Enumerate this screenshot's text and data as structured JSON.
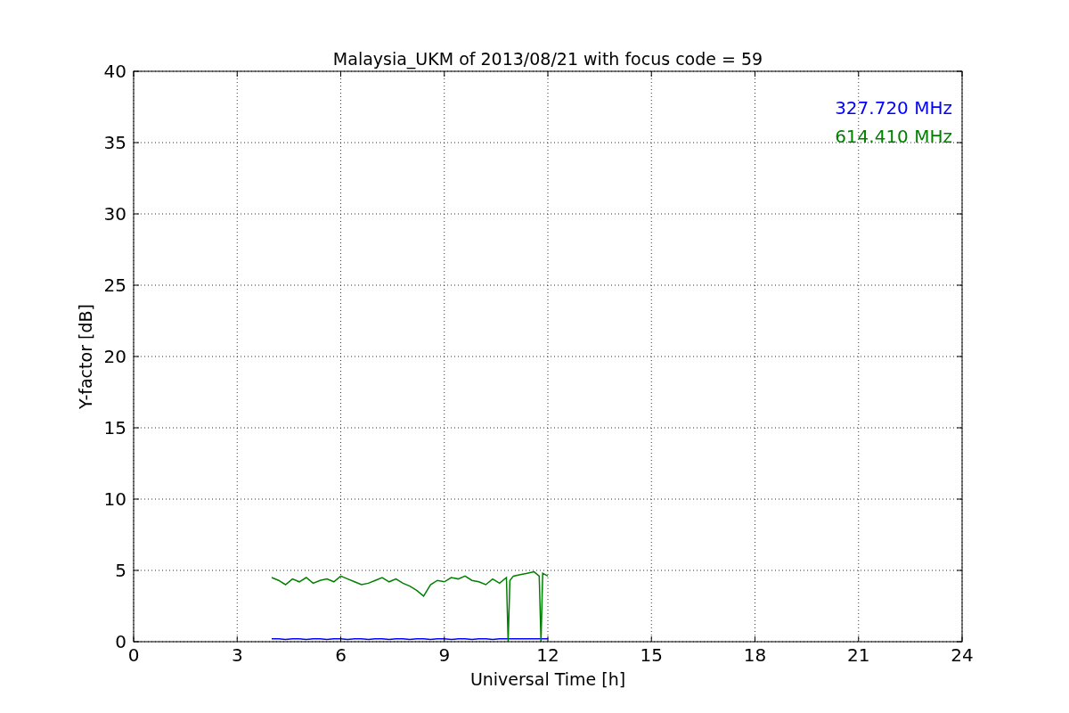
{
  "chart_data": {
    "type": "line",
    "title": "Malaysia_UKM of 2013/08/21 with focus code = 59",
    "xlabel": "Universal Time [h]",
    "ylabel": "Y-factor [dB]",
    "x": [
      4.0,
      4.2,
      4.4,
      4.6,
      4.8,
      5.0,
      5.2,
      5.4,
      5.6,
      5.8,
      6.0,
      6.2,
      6.4,
      6.6,
      6.8,
      7.0,
      7.2,
      7.4,
      7.6,
      7.8,
      8.0,
      8.2,
      8.4,
      8.6,
      8.8,
      9.0,
      9.2,
      9.4,
      9.6,
      9.8,
      10.0,
      10.2,
      10.4,
      10.6,
      10.8,
      10.85,
      10.9,
      11.0,
      11.2,
      11.4,
      11.6,
      11.75,
      11.8,
      11.85,
      12.0
    ],
    "series": [
      {
        "name": "327.720 MHz",
        "color": "#0000ff",
        "values": [
          0.2,
          0.2,
          0.15,
          0.2,
          0.2,
          0.15,
          0.2,
          0.2,
          0.15,
          0.2,
          0.2,
          0.15,
          0.2,
          0.2,
          0.15,
          0.2,
          0.2,
          0.15,
          0.2,
          0.2,
          0.15,
          0.2,
          0.2,
          0.15,
          0.2,
          0.2,
          0.15,
          0.2,
          0.2,
          0.15,
          0.2,
          0.2,
          0.15,
          0.2,
          0.2,
          0.2,
          0.2,
          0.2,
          0.2,
          0.2,
          0.2,
          0.2,
          0.2,
          0.2,
          0.2
        ]
      },
      {
        "name": "614.410 MHz",
        "color": "#008000",
        "values": [
          4.5,
          4.3,
          4.0,
          4.4,
          4.2,
          4.5,
          4.1,
          4.3,
          4.4,
          4.2,
          4.6,
          4.4,
          4.2,
          4.0,
          4.1,
          4.3,
          4.5,
          4.2,
          4.4,
          4.1,
          3.9,
          3.6,
          3.2,
          4.0,
          4.3,
          4.2,
          4.5,
          4.4,
          4.6,
          4.3,
          4.2,
          4.0,
          4.4,
          4.1,
          4.5,
          0,
          4.3,
          4.6,
          4.7,
          4.8,
          4.9,
          4.6,
          0,
          4.8,
          4.6
        ]
      }
    ],
    "grid": true,
    "xlim": [
      0,
      24
    ],
    "ylim": [
      0,
      40
    ],
    "xticks": [
      0,
      3,
      6,
      9,
      12,
      15,
      18,
      21,
      24
    ],
    "yticks": [
      0,
      5,
      10,
      15,
      20,
      25,
      30,
      35,
      40
    ]
  }
}
